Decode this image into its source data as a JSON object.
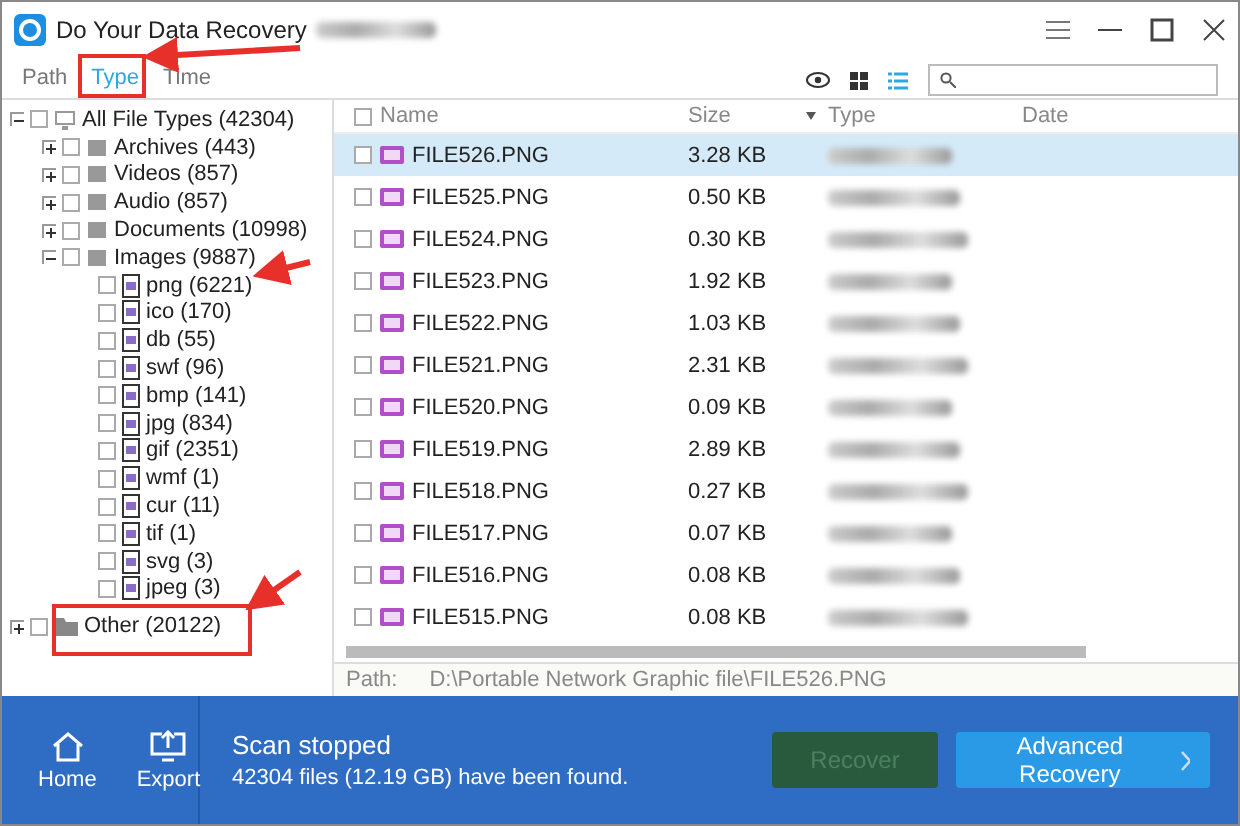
{
  "window": {
    "title": "Do Your Data Recovery"
  },
  "tabs": [
    {
      "label": "Path",
      "selected": false
    },
    {
      "label": "Type",
      "selected": true
    },
    {
      "label": "Time",
      "selected": false
    }
  ],
  "tree": [
    {
      "label": "All File Types (42304)",
      "kind": "all",
      "checked": false,
      "expanded": true,
      "children": [
        {
          "label": "Archives (443)",
          "kind": "category",
          "checked": false,
          "expanded": false
        },
        {
          "label": "Videos (857)",
          "kind": "category",
          "checked": false,
          "expanded": false
        },
        {
          "label": "Audio (857)",
          "kind": "category",
          "checked": false,
          "expanded": false
        },
        {
          "label": "Documents (10998)",
          "kind": "category",
          "checked": false,
          "expanded": false
        },
        {
          "label": "Images (9887)",
          "kind": "category",
          "checked": false,
          "expanded": true,
          "children": [
            {
              "label": "png (6221)",
              "kind": "filetype",
              "checked": false
            },
            {
              "label": "ico (170)",
              "kind": "filetype",
              "checked": false
            },
            {
              "label": "db (55)",
              "kind": "filetype",
              "checked": false
            },
            {
              "label": "swf (96)",
              "kind": "filetype",
              "checked": false
            },
            {
              "label": "bmp (141)",
              "kind": "filetype",
              "checked": false
            },
            {
              "label": "jpg (834)",
              "kind": "filetype",
              "checked": false
            },
            {
              "label": "gif (2351)",
              "kind": "filetype",
              "checked": false
            },
            {
              "label": "wmf (1)",
              "kind": "filetype",
              "checked": false
            },
            {
              "label": "cur (11)",
              "kind": "filetype",
              "checked": false
            },
            {
              "label": "tif (1)",
              "kind": "filetype",
              "checked": false
            },
            {
              "label": "svg (3)",
              "kind": "filetype",
              "checked": false
            },
            {
              "label": "jpeg (3)",
              "kind": "filetype",
              "checked": false
            }
          ]
        }
      ]
    },
    {
      "label": "Other (20122)",
      "kind": "folder",
      "checked": false,
      "expanded": false
    }
  ],
  "table": {
    "all_checked": false,
    "columns": [
      "Name",
      "Size",
      "Type",
      "Date"
    ],
    "rows": [
      {
        "name": "FILE526.PNG",
        "size": "3.28 KB",
        "selected": true,
        "checked": false
      },
      {
        "name": "FILE525.PNG",
        "size": "0.50 KB",
        "selected": false,
        "checked": false
      },
      {
        "name": "FILE524.PNG",
        "size": "0.30 KB",
        "selected": false,
        "checked": false
      },
      {
        "name": "FILE523.PNG",
        "size": "1.92 KB",
        "selected": false,
        "checked": false
      },
      {
        "name": "FILE522.PNG",
        "size": "1.03 KB",
        "selected": false,
        "checked": false
      },
      {
        "name": "FILE521.PNG",
        "size": "2.31 KB",
        "selected": false,
        "checked": false
      },
      {
        "name": "FILE520.PNG",
        "size": "0.09 KB",
        "selected": false,
        "checked": false
      },
      {
        "name": "FILE519.PNG",
        "size": "2.89 KB",
        "selected": false,
        "checked": false
      },
      {
        "name": "FILE518.PNG",
        "size": "0.27 KB",
        "selected": false,
        "checked": false
      },
      {
        "name": "FILE517.PNG",
        "size": "0.07 KB",
        "selected": false,
        "checked": false
      },
      {
        "name": "FILE516.PNG",
        "size": "0.08 KB",
        "selected": false,
        "checked": false
      },
      {
        "name": "FILE515.PNG",
        "size": "0.08 KB",
        "selected": false,
        "checked": false
      }
    ]
  },
  "path": {
    "label": "Path:",
    "value": "D:\\Portable Network Graphic file\\FILE526.PNG"
  },
  "footer": {
    "buttons": [
      {
        "label": "Home",
        "kind": "home"
      },
      {
        "label": "Export",
        "kind": "export"
      }
    ],
    "status_title": "Scan stopped",
    "status_text": "42304 files (12.19 GB) have been found.",
    "actions": [
      {
        "label": "Recover",
        "disabled": true,
        "kind": "recover"
      },
      {
        "label": "Advanced Recovery",
        "disabled": false,
        "kind": "advanced"
      }
    ]
  }
}
